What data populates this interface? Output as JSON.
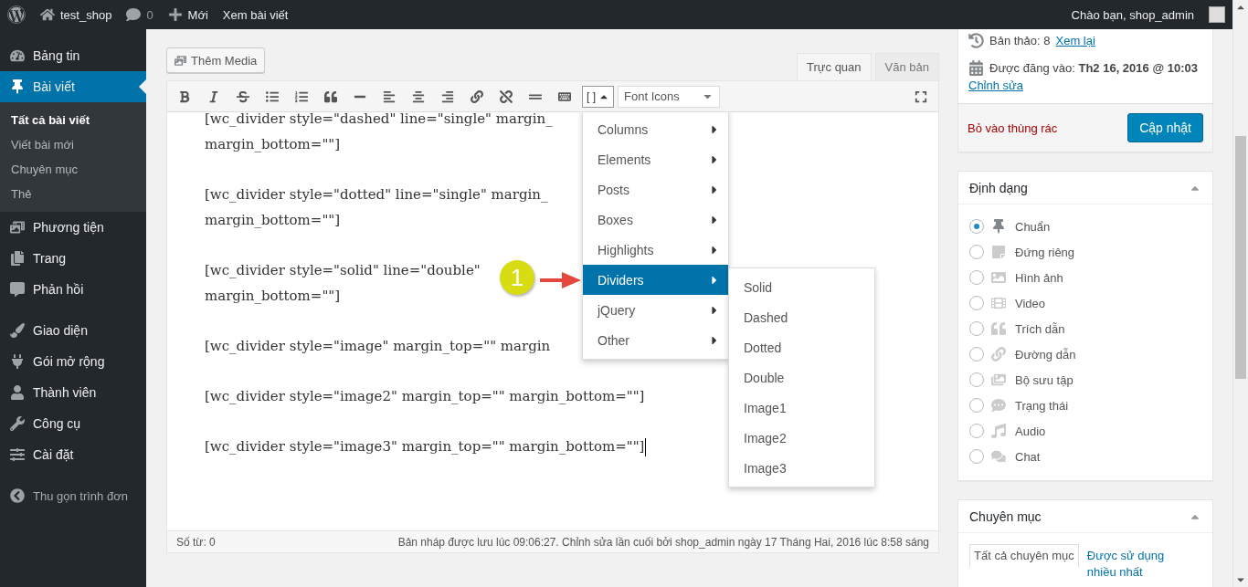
{
  "admin_bar": {
    "site": "test_shop",
    "comments": "0",
    "new": "Mới",
    "view": "Xem bài viết",
    "greeting": "Chào bạn, shop_admin"
  },
  "sidebar": {
    "groups": [
      [
        {
          "label": "Bảng tin",
          "selected": false
        },
        {
          "label": "Bài viết",
          "selected": true,
          "children": [
            {
              "label": "Tất cả bài viết",
              "selected": true
            },
            {
              "label": "Viết bài mới",
              "selected": false
            },
            {
              "label": "Chuyên mục",
              "selected": false
            },
            {
              "label": "Thẻ",
              "selected": false
            }
          ]
        },
        {
          "label": "Phương tiện",
          "selected": false
        },
        {
          "label": "Trang",
          "selected": false
        },
        {
          "label": "Phản hồi",
          "selected": false
        }
      ],
      [
        {
          "label": "Giao diện",
          "selected": false
        },
        {
          "label": "Gói mở rộng",
          "selected": false
        },
        {
          "label": "Thành viên",
          "selected": false
        },
        {
          "label": "Công cụ",
          "selected": false
        },
        {
          "label": "Cài đặt",
          "selected": false
        }
      ]
    ],
    "collapse": "Thu gọn trình đơn"
  },
  "editor": {
    "add_media": "Thêm Media",
    "tabs": [
      {
        "label": "Trực quan",
        "selected": true
      },
      {
        "label": "Văn bản",
        "selected": false
      }
    ],
    "shortcode_button": "[ ]",
    "font_select": "Font Icons",
    "paragraphs": [
      [
        "[wc_divider style=\"dashed\" line=\"single\" margin_",
        "margin_bottom=\"\"]"
      ],
      [
        "[wc_divider style=\"dotted\" line=\"single\" margin_",
        "margin_bottom=\"\"]"
      ],
      [
        "[wc_divider style=\"solid\" line=\"double\"",
        "margin_bottom=\"\"]"
      ],
      [
        "[wc_divider style=\"image\" margin_top=\"\" margin"
      ],
      [
        "[wc_divider style=\"image2\" margin_top=\"\" margin_bottom=\"\"]"
      ],
      [
        "[wc_divider style=\"image3\" margin_top=\"\" margin_bottom=\"\"]"
      ]
    ],
    "menu": {
      "items": [
        {
          "label": "Columns",
          "selected": false
        },
        {
          "label": "Elements",
          "selected": false
        },
        {
          "label": "Posts",
          "selected": false
        },
        {
          "label": "Boxes",
          "selected": false
        },
        {
          "label": "Highlights",
          "selected": false
        },
        {
          "label": "Dividers",
          "selected": true
        },
        {
          "label": "jQuery",
          "selected": false
        },
        {
          "label": "Other",
          "selected": false
        }
      ],
      "submenu": [
        "Solid",
        "Dashed",
        "Dotted",
        "Double",
        "Image1",
        "Image2",
        "Image3"
      ]
    },
    "callout": "1",
    "word_count": "Số từ: 0",
    "autosave": "Bản nháp được lưu lúc 09:06:27. Chỉnh sửa lần cuối bởi shop_admin ngày 17 Tháng Hai, 2016 lúc 8:58 sáng"
  },
  "publish": {
    "revisions": "Bản thảo: 8",
    "revisions_link": "Xem lại",
    "published": "Được đăng vào: **Th2 16, 2016 @ 10:03**",
    "edit_link": "Chỉnh sửa",
    "trash": "Bỏ vào thùng rác",
    "update": "Cập nhật"
  },
  "format": {
    "title": "Định dạng",
    "options": [
      {
        "label": "Chuẩn",
        "selected": true
      },
      {
        "label": "Đứng riêng",
        "selected": false
      },
      {
        "label": "Hình ảnh",
        "selected": false
      },
      {
        "label": "Video",
        "selected": false
      },
      {
        "label": "Trích dẫn",
        "selected": false
      },
      {
        "label": "Đường dẫn",
        "selected": false
      },
      {
        "label": "Bộ sưu tập",
        "selected": false
      },
      {
        "label": "Trạng thái",
        "selected": false
      },
      {
        "label": "Audio",
        "selected": false
      },
      {
        "label": "Chat",
        "selected": false
      }
    ]
  },
  "categories": {
    "title": "Chuyên mục",
    "tabs": [
      {
        "label": "Tất cả chuyên mục",
        "selected": true
      },
      {
        "label": "Được sử dụng nhiều nhất",
        "selected": false
      }
    ]
  }
}
